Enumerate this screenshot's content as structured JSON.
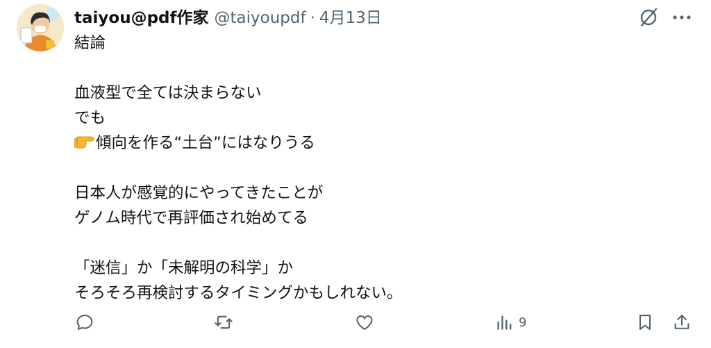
{
  "author": {
    "display_name": "taiyou@pdf作家",
    "handle": "@taiyoupdf",
    "separator": "·",
    "date": "4月13日"
  },
  "post": {
    "lines": [
      "結論",
      "",
      "血液型で全ては決まらない",
      "でも",
      "傾向を作る“土台”にはなりうる",
      "",
      "日本人が感覚的にやってきたことが",
      "ゲノム時代で再評価され始めてる",
      "",
      "「迷信」か「未解明の科学」か",
      "そろそろ再検討するタイミングかもしれない。"
    ],
    "emoji_icon": "pointing-right-hand-icon"
  },
  "actions": {
    "reply_icon": "reply-icon",
    "repost_icon": "repost-icon",
    "like_icon": "like-icon",
    "views_icon": "views-icon",
    "views_count": "9",
    "bookmark_icon": "bookmark-icon",
    "share_icon": "share-icon"
  },
  "colors": {
    "text": "#0f1419",
    "secondary": "#536471",
    "emoji": "#f5b82e"
  }
}
